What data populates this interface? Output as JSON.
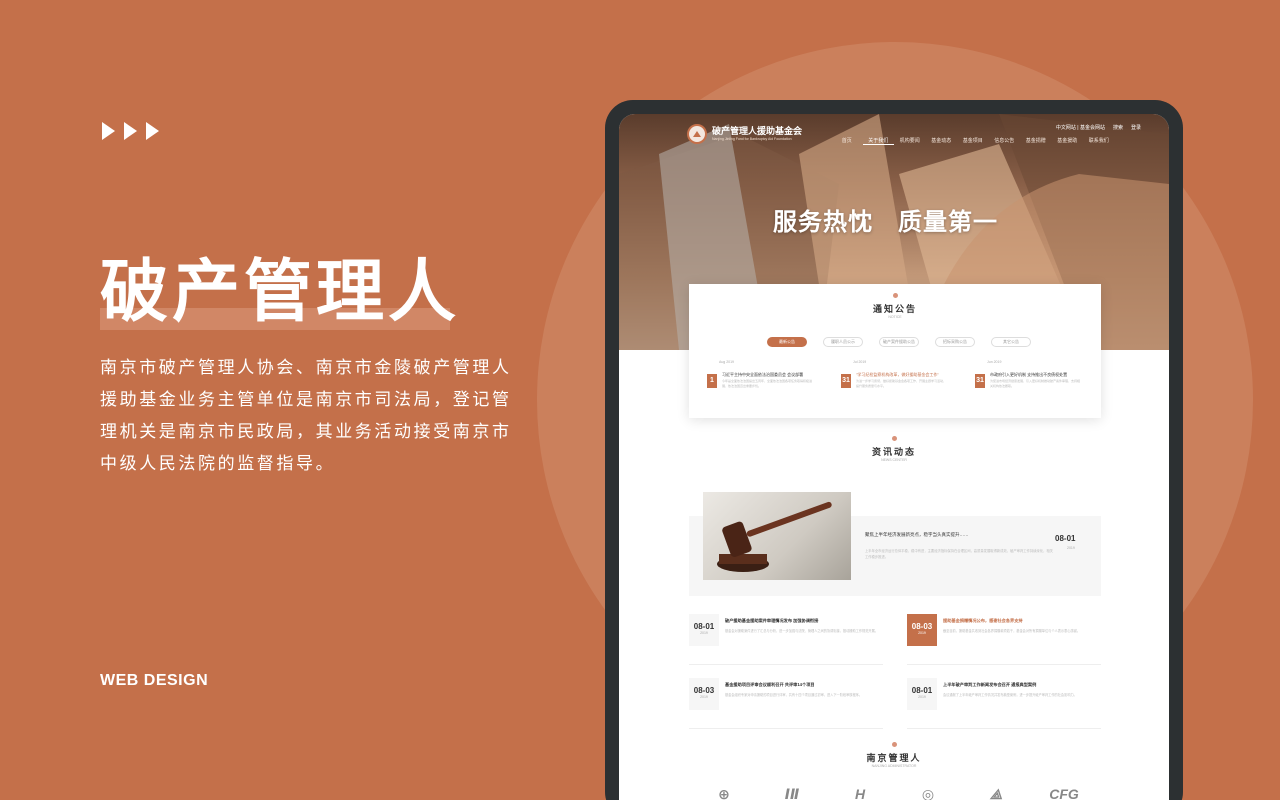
{
  "left": {
    "title": "破产管理人",
    "description": "南京市破产管理人协会、南京市金陵破产管理人援助基金业务主管单位是南京市司法局，登记管理机关是南京市民政局，其业务活动接受南京市中级人民法院的监督指导。",
    "footer_label": "WEB DESIGN"
  },
  "site": {
    "logo_name": "破产管理人援助基金会",
    "logo_sub": "Nanjing Jinling Fund for Bankruptcy Aid Foundation",
    "util_links": [
      "中文网站 | 基金会网站",
      "搜索",
      "登录"
    ],
    "menu": [
      "首页",
      "关于我们",
      "机构要闻",
      "基金动态",
      "基金项目",
      "信息公告",
      "基金捐赠",
      "基金援助",
      "联系我们"
    ],
    "slogan": "服务热忱　质量第一"
  },
  "notice": {
    "title": "通知公告",
    "subtitle": "NOTICE",
    "tabs": [
      "最新公告",
      "履职人员公示",
      "破产案件援助公告",
      "招标采购公告",
      "其它公告"
    ],
    "items": [
      {
        "date": "Aug 2019",
        "day": "1",
        "title": "习近平主持中央全面依法治国委员会 会议部署",
        "text": "今年是全面依法治国提出五周年，全面依法治国各项任务取得积极进展，依法治国迈出重要步伐。"
      },
      {
        "date": "Jul 2019",
        "day": "31",
        "title": "\"学习纪检监察机构改革，做好援助基金会工作\"",
        "text": "为进一步学习贯彻，做好援助基金会各项工作，开展主题学习活动，提升服务质量与水平。"
      },
      {
        "date": "Jun 2019",
        "day": "31",
        "title": "市政府引入更好机制 支持推出不良债权处置",
        "text": "为促进市场经济健康发展，引入更好机制推动破产案件审理，支持相关机构依法履职。"
      }
    ]
  },
  "news": {
    "title": "资讯动态",
    "subtitle": "NEWS CENTER",
    "feature": {
      "title": "聚焦上半年经济发展新亮点，稳字当头真实提升……",
      "text": "上半年全市经济运行总体平稳，稳中有进，主要经济指标保持在合理区间，高质量发展取得新成效，破产审判工作持续深化，相关工作稳步推进。",
      "date": "08-01",
      "year": "2019"
    },
    "items": [
      {
        "date": "08-01",
        "year": "2019",
        "title": "破产援助基金援助案件审理情况发布 加强协调衔接",
        "text": "基金会对援助案件进行了汇总与分析，进一步加强与法院、管理人之间的协调衔接，推动援助工作规范开展。",
        "highlight": false
      },
      {
        "date": "08-03",
        "year": "2019",
        "title": "援助基金捐赠情况公布，感谢社会各界支持",
        "text": "截至目前，援助基金共收到社会各界捐赠款项若干，基金会对所有捐赠单位与个人表示衷心感谢。",
        "highlight": true
      },
      {
        "date": "08-03",
        "year": "2019",
        "title": "基金援助项目评审会议顺利召开 共评审14个项目",
        "text": "基金会组织专家对申请援助的项目进行评审，共有十四个项目通过初审，进入下一阶段审核程序。",
        "highlight": false
      },
      {
        "date": "08-01",
        "year": "2019",
        "title": "上半年破产审判工作新闻发布会召开 通报典型案例",
        "text": "会议通报了上半年破产审判工作情况并发布典型案例，进一步提升破产审判工作的社会影响力。",
        "highlight": false
      }
    ]
  },
  "orgs": {
    "title": "南京管理人",
    "subtitle": "NANJING ADMINISTRATOR",
    "partners": [
      "⊕",
      "ⅠⅡ",
      "H",
      "◎",
      "⟁",
      "CFG"
    ]
  }
}
